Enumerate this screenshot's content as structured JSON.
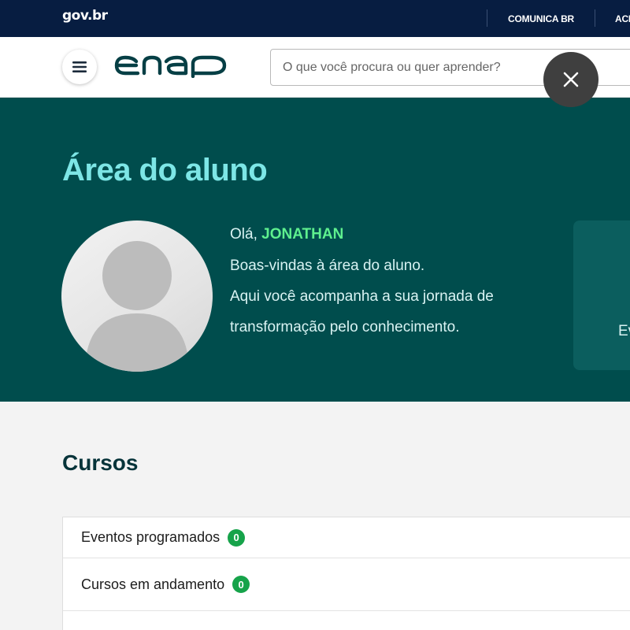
{
  "gov_bar": {
    "logo": "gov.br",
    "links": [
      "COMUNICA BR",
      "ACE"
    ]
  },
  "header": {
    "logo_text": "enap",
    "search": {
      "placeholder": "O que você procura ou quer aprender?",
      "value": ""
    }
  },
  "hero": {
    "title": "Área do aluno",
    "greeting_prefix": "Olá,",
    "user_name": "JONATHAN",
    "lines": [
      "Boas-vindas à área do aluno.",
      "Aqui você acompanha a sua jornada de",
      "transformação pelo conhecimento."
    ],
    "side_card_text": "Ev"
  },
  "courses": {
    "title": "Cursos",
    "rows": [
      {
        "label": "Eventos programados",
        "count": "0"
      },
      {
        "label": "Cursos em andamento",
        "count": "0"
      }
    ]
  },
  "icons": {
    "menu": "hamburger-icon",
    "close": "close-icon",
    "avatar": "user-avatar-icon"
  },
  "colors": {
    "gov_bar": "#071d41",
    "hero_bg": "#004d4d",
    "title_accent": "#7de6e6",
    "name_accent": "#5ef08e",
    "badge": "#16a34a"
  }
}
